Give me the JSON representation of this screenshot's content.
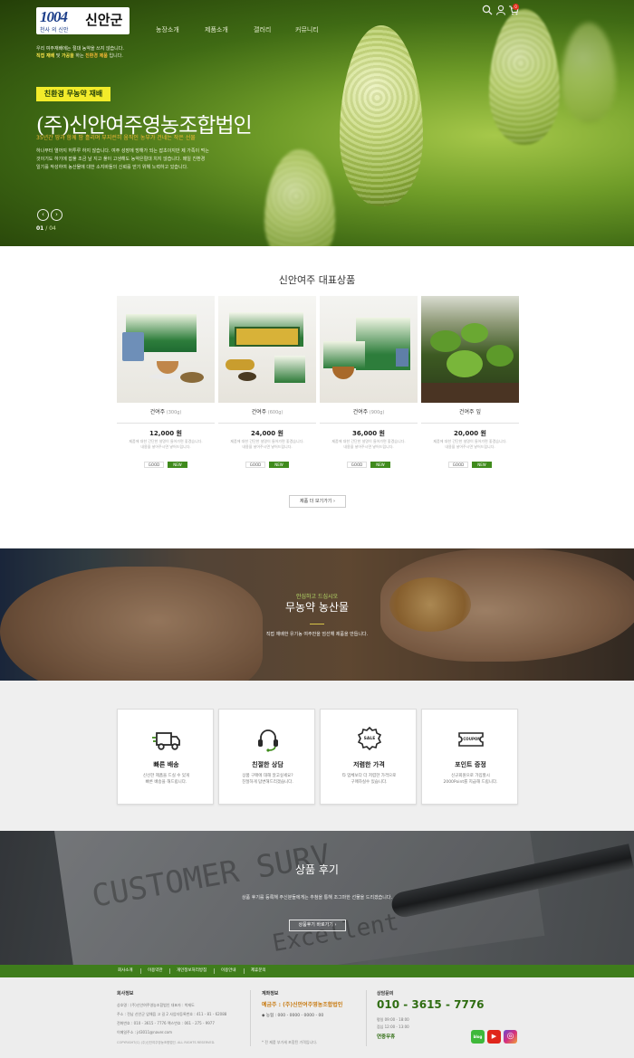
{
  "header": {
    "logo_number": "1004",
    "logo_sub": "천사 의 신안",
    "logo_name": "신안군",
    "nav": [
      "농장소개",
      "제품소개",
      "갤러리",
      "커뮤니티"
    ],
    "cart_count": "0"
  },
  "hero": {
    "intro_line1": "우리 여주재배에는 절대 농약을 쓰지 않습니다.",
    "intro_line2_a": "직접 재배",
    "intro_line2_b": " 및 ",
    "intro_line2_c": "가공을",
    "intro_line2_d": " 하는 ",
    "intro_line2_e": "친환경 제품",
    "intro_line2_f": " 입니다.",
    "badge": "친환경 무농약 재배",
    "title": "(주)신안여주영농조합법인",
    "subtitle": "35년간 땅과 함께 땀 흘리며 부지런히 움직인 농부가 건네는 작은 선물",
    "desc_line1": "하나부터 열까지 허투루 하지 않습니다. 여주 성장에 방해가 되는 잡초이지만 제 가족이 먹는",
    "desc_line2": "것이기도 하기에 잡풀 조금 날 지고 풀이 고생해도 농약은절대 치지 않습니다. 매일 친환경",
    "desc_line3": "일기를 작성하여 농산물에 대한 소지바들의 신뢰를 얻기 위해 노력하고 있습니다.",
    "prev_arrow": "‹",
    "next_arrow": "›",
    "page_current": "01",
    "page_total": " / 04"
  },
  "products": {
    "title": "신안여주 대표상품",
    "more_label": "제품 더 보기가기  ›",
    "tag_good": "GOOD",
    "tag_new": "NEW",
    "desc_line1": "제품에 대한 간단한 설명이 들어가면 좋겠습니다.",
    "desc_line2": "내용을 넣어주시면 넣어드립니다.",
    "items": [
      {
        "name": "건여주",
        "unit": " (300g)",
        "price": "12,000 원"
      },
      {
        "name": "건여주",
        "unit": " (600g)",
        "price": "24,000 원"
      },
      {
        "name": "건여주",
        "unit": " (900g)",
        "price": "36,000 원"
      },
      {
        "name": "건여주 잎",
        "unit": "",
        "price": "20,000 원"
      }
    ]
  },
  "organic": {
    "subtitle": "안심하고 드십시오",
    "title": "무농약 농산물",
    "desc": "직접 재배한 유기농 여주만을 엄선해 제품을 만듭니다."
  },
  "features": [
    {
      "icon": "truck-icon",
      "title": "빠른 배송",
      "line1": "신선한 제품을 드실 수 있게",
      "line2": "빠른 배송을 해드립니다."
    },
    {
      "icon": "headset-icon",
      "title": "친절한 상담",
      "line1": "상품 구매에 대해 알고싶세요?",
      "line2": "친절하게 답변해드리겠습니다."
    },
    {
      "icon": "sale-tag-icon",
      "title": "저렴한 가격",
      "line1": "타 업체보다 더 저렴한 가격으로",
      "line2": "구매하실수 있습니다."
    },
    {
      "icon": "coupon-icon",
      "title": "포인트 증정",
      "line1": "신규회원으로 가입할시",
      "line2": "2000Point를 지급해 드립니다."
    }
  ],
  "feature_badges": {
    "sale": "SALE",
    "coupon": "COUPON"
  },
  "review": {
    "bg_text1": "CUSTOMER SURV",
    "bg_text2": "Excellent",
    "title": "상품 후기",
    "desc": "상품 후기를 등록해 주신분들에게는 추첨을 통해 조그마한 선물을 드리겠습니다.",
    "button": "상품후기 바로가기  ›"
  },
  "footer_nav": [
    "회사소개",
    "이용약관",
    "개인정보처리방침",
    "이용안내",
    "제휴문의"
  ],
  "footer": {
    "company_title": "회사정보",
    "company_line1": "상호명 : (주)신안여주영농조합법인     대표자 : 박재도",
    "company_line2": "주소 : 전남 신안군 압해읍 고 길 2     사업자등록번호 : 411 - 81 - 62088",
    "company_line3": "전화번호 : 010 - 3615 - 7776     팩스번호 : 061 - 275 - 9977",
    "company_line4": "이메일주소 : jd3011@naver.com",
    "copyright": "COPYRIGHT(C) (주)신안여주영농조합법인. ALL RIGHTS RESERVED.",
    "account_title": "계좌정보",
    "account_holder": "예금주 : (주)신안여주영농조합법인",
    "account_bank": "◆ 농협 : 000 - 0000 - 0000 - 00",
    "account_note": "* 전 제품 부가세 포함된 가격입니다.",
    "cs_title": "상담문의",
    "cs_phone": "010 - 3615 - 7776",
    "cs_weekday": "평일      09:00 - 18:00",
    "cs_lunch": "점심      12:00 - 13:00",
    "cs_holiday": "연중무휴",
    "sns_blog": "blog",
    "sns_youtube": "▶",
    "sns_instagram": "◎"
  },
  "colors": {
    "primary_green": "#3f7d1c",
    "accent_yellow": "#f2eb2a",
    "phone_green": "#2f6d12",
    "account_orange": "#c87b13"
  }
}
